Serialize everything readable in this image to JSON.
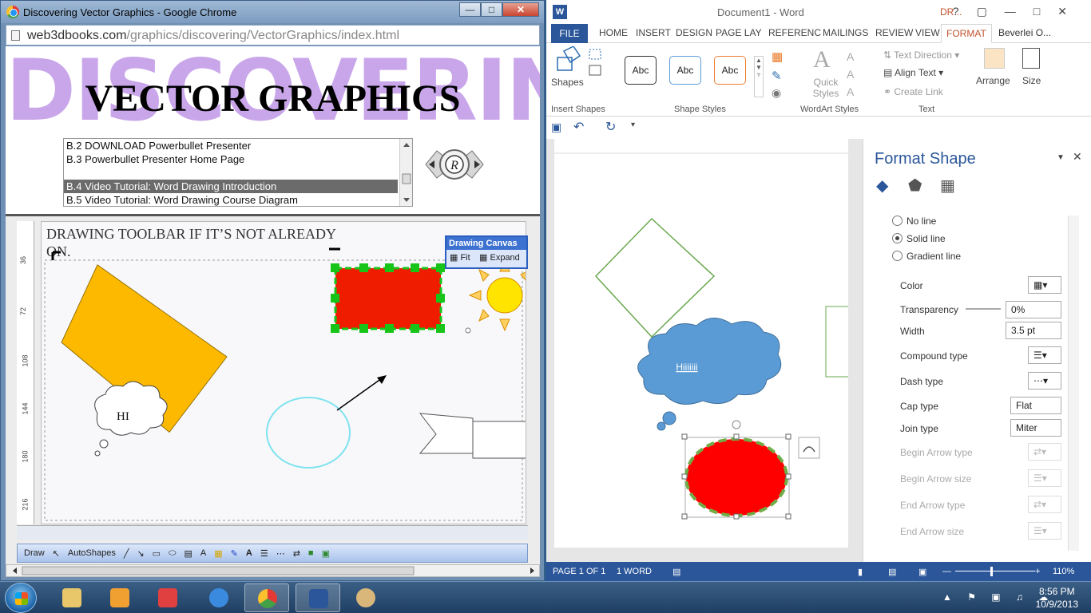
{
  "chrome": {
    "title": "Discovering Vector Graphics - Google Chrome",
    "url_host": "web3dbooks.com",
    "url_path": "/graphics/discovering/VectorGraphics/index.html",
    "banner_bg_text": "DISCOVERING",
    "banner_title": "VECTOR GRAPHICS",
    "list_items": [
      "B.2 DOWNLOAD Powerbullet Presenter",
      "B.3 Powerbullet Presenter Home Page",
      "",
      "B.4 Video Tutorial: Word Drawing Introduction",
      "B.5 Video Tutorial: Word Drawing Course Diagram"
    ],
    "selected_index": 3,
    "video": {
      "doc_heading_line1": "DRAWING TOOLBAR IF IT’S NOT ALREADY",
      "doc_heading_line2": "ON.",
      "ruler_ticks": [
        "36",
        "72",
        "108",
        "144",
        "180",
        "216"
      ],
      "callout_text": "HI",
      "drawing_canvas_title": "Drawing Canvas",
      "fit_label": "Fit",
      "expand_label": "Expand",
      "draw_label": "Draw",
      "autoshapes_label": "AutoShapes",
      "colors": {
        "diamond": "#fdb900",
        "rect": "#f01c00",
        "handles": "#19c419",
        "sun": "#ffe400",
        "circle_outline": "#7fe3ef"
      }
    }
  },
  "word": {
    "doc_title": "Document1 - Word",
    "context_tab": "DR...",
    "tabs": [
      "FILE",
      "HOME",
      "INSERT",
      "DESIGN",
      "PAGE LAY",
      "REFERENC",
      "MAILINGS",
      "REVIEW",
      "VIEW",
      "FORMAT"
    ],
    "user": "Beverlei O...",
    "ribbon": {
      "shapes_label": "Shapes",
      "insert_shapes_group": "Insert Shapes",
      "style_sample": "Abc",
      "shape_styles_group": "Shape Styles",
      "quick_styles_label": "Quick Styles",
      "wordart_group": "WordArt Styles",
      "text_direction": "Text Direction",
      "align_text": "Align Text",
      "create_link": "Create Link",
      "text_group": "Text",
      "arrange_label": "Arrange",
      "size_label": "Size"
    },
    "doc": {
      "cloud_text": "Hiiiiiii",
      "colors": {
        "diamond_outline": "#6aa84f",
        "cloud": "#5b9bd5",
        "ellipse_fill": "#ff0000",
        "ellipse_outline": "#70ad47"
      }
    },
    "format_pane": {
      "title": "Format Shape",
      "line_options": [
        "No line",
        "Solid line",
        "Gradient line"
      ],
      "selected_line_option": 1,
      "color_label": "Color",
      "transparency_label": "Transparency",
      "transparency_value": "0%",
      "width_label": "Width",
      "width_value": "3.5 pt",
      "compound_label": "Compound type",
      "dash_label": "Dash type",
      "cap_label": "Cap type",
      "cap_value": "Flat",
      "join_label": "Join type",
      "join_value": "Miter",
      "begin_arrow_type": "Begin Arrow type",
      "begin_arrow_size": "Begin Arrow size",
      "end_arrow_type": "End Arrow type",
      "end_arrow_size": "End Arrow size"
    },
    "status": {
      "page": "PAGE 1 OF 1",
      "words": "1 WORD",
      "zoom": "110%"
    }
  },
  "taskbar": {
    "time": "8:56 PM",
    "date": "10/9/2013"
  }
}
